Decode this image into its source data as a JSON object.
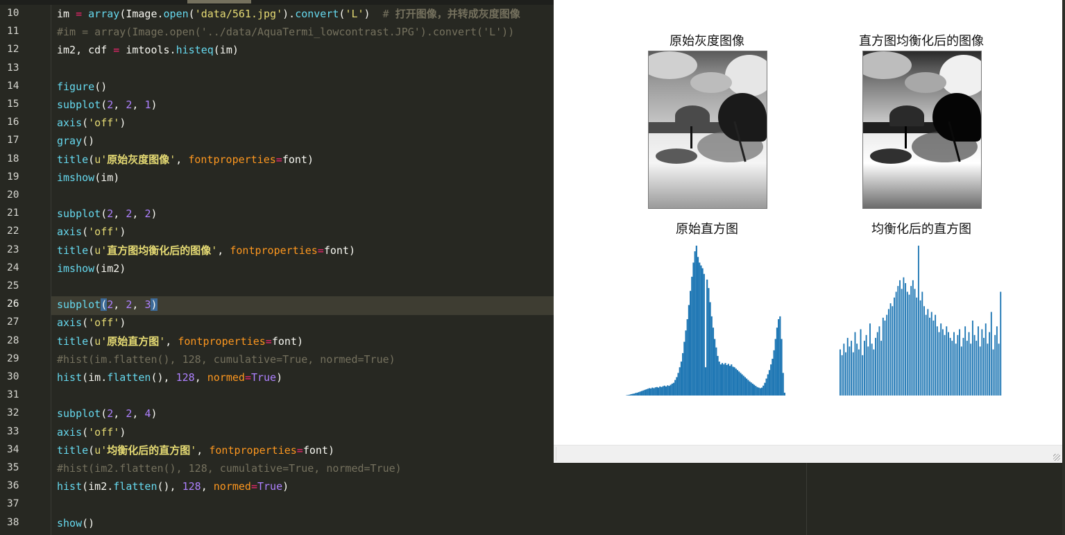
{
  "editor": {
    "lines": [
      {
        "num": "10",
        "tokens": [
          {
            "t": "im ",
            "c": "kw"
          },
          {
            "t": "=",
            "c": "op"
          },
          {
            "t": " ",
            "c": "kw"
          },
          {
            "t": "array",
            "c": "fn"
          },
          {
            "t": "(Image.",
            "c": "kw"
          },
          {
            "t": "open",
            "c": "fn"
          },
          {
            "t": "(",
            "c": "kw"
          },
          {
            "t": "'data/561.jpg'",
            "c": "str"
          },
          {
            "t": ").",
            "c": "kw"
          },
          {
            "t": "convert",
            "c": "fn"
          },
          {
            "t": "(",
            "c": "kw"
          },
          {
            "t": "'L'",
            "c": "str"
          },
          {
            "t": ")  ",
            "c": "kw"
          },
          {
            "t": "# ",
            "c": "comment"
          },
          {
            "t": "打开图像，并转成灰度图像",
            "c": "cjk-comment"
          }
        ]
      },
      {
        "num": "11",
        "tokens": [
          {
            "t": "#im = array(Image.open('../data/AquaTermi_lowcontrast.JPG').convert('L'))",
            "c": "comment"
          }
        ]
      },
      {
        "num": "12",
        "tokens": [
          {
            "t": "im2, cdf ",
            "c": "kw"
          },
          {
            "t": "=",
            "c": "op"
          },
          {
            "t": " imtools.",
            "c": "kw"
          },
          {
            "t": "histeq",
            "c": "fn"
          },
          {
            "t": "(im)",
            "c": "kw"
          }
        ]
      },
      {
        "num": "13",
        "tokens": []
      },
      {
        "num": "14",
        "tokens": [
          {
            "t": "figure",
            "c": "fn"
          },
          {
            "t": "()",
            "c": "kw"
          }
        ]
      },
      {
        "num": "15",
        "tokens": [
          {
            "t": "subplot",
            "c": "fn"
          },
          {
            "t": "(",
            "c": "kw"
          },
          {
            "t": "2",
            "c": "num"
          },
          {
            "t": ", ",
            "c": "kw"
          },
          {
            "t": "2",
            "c": "num"
          },
          {
            "t": ", ",
            "c": "kw"
          },
          {
            "t": "1",
            "c": "num"
          },
          {
            "t": ")",
            "c": "kw"
          }
        ]
      },
      {
        "num": "16",
        "tokens": [
          {
            "t": "axis",
            "c": "fn"
          },
          {
            "t": "(",
            "c": "kw"
          },
          {
            "t": "'off'",
            "c": "str"
          },
          {
            "t": ")",
            "c": "kw"
          }
        ]
      },
      {
        "num": "17",
        "tokens": [
          {
            "t": "gray",
            "c": "fn"
          },
          {
            "t": "()",
            "c": "kw"
          }
        ]
      },
      {
        "num": "18",
        "tokens": [
          {
            "t": "title",
            "c": "fn"
          },
          {
            "t": "(",
            "c": "kw"
          },
          {
            "t": "u'",
            "c": "str"
          },
          {
            "t": "原始灰度图像",
            "c": "cjk"
          },
          {
            "t": "'",
            "c": "str"
          },
          {
            "t": ", ",
            "c": "kw"
          },
          {
            "t": "fontproperties",
            "c": "param"
          },
          {
            "t": "=",
            "c": "op"
          },
          {
            "t": "font)",
            "c": "kw"
          }
        ]
      },
      {
        "num": "19",
        "tokens": [
          {
            "t": "imshow",
            "c": "fn"
          },
          {
            "t": "(im)",
            "c": "kw"
          }
        ]
      },
      {
        "num": "20",
        "tokens": []
      },
      {
        "num": "21",
        "tokens": [
          {
            "t": "subplot",
            "c": "fn"
          },
          {
            "t": "(",
            "c": "kw"
          },
          {
            "t": "2",
            "c": "num"
          },
          {
            "t": ", ",
            "c": "kw"
          },
          {
            "t": "2",
            "c": "num"
          },
          {
            "t": ", ",
            "c": "kw"
          },
          {
            "t": "2",
            "c": "num"
          },
          {
            "t": ")",
            "c": "kw"
          }
        ]
      },
      {
        "num": "22",
        "tokens": [
          {
            "t": "axis",
            "c": "fn"
          },
          {
            "t": "(",
            "c": "kw"
          },
          {
            "t": "'off'",
            "c": "str"
          },
          {
            "t": ")",
            "c": "kw"
          }
        ]
      },
      {
        "num": "23",
        "tokens": [
          {
            "t": "title",
            "c": "fn"
          },
          {
            "t": "(",
            "c": "kw"
          },
          {
            "t": "u'",
            "c": "str"
          },
          {
            "t": "直方图均衡化后的图像",
            "c": "cjk"
          },
          {
            "t": "'",
            "c": "str"
          },
          {
            "t": ", ",
            "c": "kw"
          },
          {
            "t": "fontproperties",
            "c": "param"
          },
          {
            "t": "=",
            "c": "op"
          },
          {
            "t": "font)",
            "c": "kw"
          }
        ]
      },
      {
        "num": "24",
        "tokens": [
          {
            "t": "imshow",
            "c": "fn"
          },
          {
            "t": "(im2)",
            "c": "kw"
          }
        ]
      },
      {
        "num": "25",
        "tokens": []
      },
      {
        "num": "26",
        "active": true,
        "tokens": [
          {
            "t": "subplot",
            "c": "fn"
          },
          {
            "t": "(",
            "c": "bracket-hl"
          },
          {
            "t": "2",
            "c": "num"
          },
          {
            "t": ", ",
            "c": "kw"
          },
          {
            "t": "2",
            "c": "num"
          },
          {
            "t": ", ",
            "c": "kw"
          },
          {
            "t": "3",
            "c": "num"
          },
          {
            "t": ")",
            "c": "bracket-hl"
          }
        ]
      },
      {
        "num": "27",
        "tokens": [
          {
            "t": "axis",
            "c": "fn"
          },
          {
            "t": "(",
            "c": "kw"
          },
          {
            "t": "'off'",
            "c": "str"
          },
          {
            "t": ")",
            "c": "kw"
          }
        ]
      },
      {
        "num": "28",
        "tokens": [
          {
            "t": "title",
            "c": "fn"
          },
          {
            "t": "(",
            "c": "kw"
          },
          {
            "t": "u'",
            "c": "str"
          },
          {
            "t": "原始直方图",
            "c": "cjk"
          },
          {
            "t": "'",
            "c": "str"
          },
          {
            "t": ", ",
            "c": "kw"
          },
          {
            "t": "fontproperties",
            "c": "param"
          },
          {
            "t": "=",
            "c": "op"
          },
          {
            "t": "font)",
            "c": "kw"
          }
        ]
      },
      {
        "num": "29",
        "tokens": [
          {
            "t": "#hist(im.flatten(), 128, cumulative=True, normed=True)",
            "c": "comment"
          }
        ]
      },
      {
        "num": "30",
        "tokens": [
          {
            "t": "hist",
            "c": "fn"
          },
          {
            "t": "(im.",
            "c": "kw"
          },
          {
            "t": "flatten",
            "c": "fn"
          },
          {
            "t": "(), ",
            "c": "kw"
          },
          {
            "t": "128",
            "c": "num"
          },
          {
            "t": ", ",
            "c": "kw"
          },
          {
            "t": "normed",
            "c": "param"
          },
          {
            "t": "=",
            "c": "op"
          },
          {
            "t": "True",
            "c": "const"
          },
          {
            "t": ")",
            "c": "kw"
          }
        ]
      },
      {
        "num": "31",
        "tokens": []
      },
      {
        "num": "32",
        "tokens": [
          {
            "t": "subplot",
            "c": "fn"
          },
          {
            "t": "(",
            "c": "kw"
          },
          {
            "t": "2",
            "c": "num"
          },
          {
            "t": ", ",
            "c": "kw"
          },
          {
            "t": "2",
            "c": "num"
          },
          {
            "t": ", ",
            "c": "kw"
          },
          {
            "t": "4",
            "c": "num"
          },
          {
            "t": ")",
            "c": "kw"
          }
        ]
      },
      {
        "num": "33",
        "tokens": [
          {
            "t": "axis",
            "c": "fn"
          },
          {
            "t": "(",
            "c": "kw"
          },
          {
            "t": "'off'",
            "c": "str"
          },
          {
            "t": ")",
            "c": "kw"
          }
        ]
      },
      {
        "num": "34",
        "tokens": [
          {
            "t": "title",
            "c": "fn"
          },
          {
            "t": "(",
            "c": "kw"
          },
          {
            "t": "u'",
            "c": "str"
          },
          {
            "t": "均衡化后的直方图",
            "c": "cjk"
          },
          {
            "t": "'",
            "c": "str"
          },
          {
            "t": ", ",
            "c": "kw"
          },
          {
            "t": "fontproperties",
            "c": "param"
          },
          {
            "t": "=",
            "c": "op"
          },
          {
            "t": "font)",
            "c": "kw"
          }
        ]
      },
      {
        "num": "35",
        "tokens": [
          {
            "t": "#hist(im2.flatten(), 128, cumulative=True, normed=True)",
            "c": "comment"
          }
        ]
      },
      {
        "num": "36",
        "tokens": [
          {
            "t": "hist",
            "c": "fn"
          },
          {
            "t": "(im2.",
            "c": "kw"
          },
          {
            "t": "flatten",
            "c": "fn"
          },
          {
            "t": "(), ",
            "c": "kw"
          },
          {
            "t": "128",
            "c": "num"
          },
          {
            "t": ", ",
            "c": "kw"
          },
          {
            "t": "normed",
            "c": "param"
          },
          {
            "t": "=",
            "c": "op"
          },
          {
            "t": "True",
            "c": "const"
          },
          {
            "t": ")",
            "c": "kw"
          }
        ]
      },
      {
        "num": "37",
        "tokens": []
      },
      {
        "num": "38",
        "tokens": [
          {
            "t": "show",
            "c": "fn"
          },
          {
            "t": "()",
            "c": "kw"
          }
        ]
      }
    ]
  },
  "figure": {
    "titles": {
      "original_image": "原始灰度图像",
      "equalized_image": "直方图均衡化后的图像",
      "original_hist": "原始直方图",
      "equalized_hist": "均衡化后的直方图"
    },
    "bar_color": "#1f77b4"
  },
  "chart_data": [
    {
      "type": "bar",
      "title": "原始直方图",
      "bins": 128,
      "values": [
        0.1,
        0.2,
        0.3,
        0.5,
        0.6,
        0.7,
        0.9,
        1.0,
        1.2,
        1.4,
        1.6,
        1.8,
        2.0,
        2.2,
        2.4,
        2.6,
        2.5,
        2.8,
        2.6,
        2.9,
        3.0,
        2.8,
        3.2,
        3.0,
        3.3,
        3.5,
        3.2,
        3.6,
        3.4,
        3.8,
        4.2,
        4.5,
        5.5,
        6.5,
        8.0,
        10.0,
        12.0,
        15.0,
        19.0,
        23.0,
        27.0,
        32.0,
        37.0,
        42.0,
        47.0,
        51.0,
        53.0,
        49.0,
        47.0,
        46.0,
        45.0,
        43.0,
        10.0,
        41.0,
        38.0,
        33.0,
        28.0,
        24.0,
        20.0,
        17.0,
        14.0,
        12.0,
        11.0,
        11.5,
        11.0,
        11.5,
        10.8,
        11.2,
        10.5,
        11.0,
        10.2,
        10.0,
        9.5,
        9.0,
        8.5,
        8.0,
        7.5,
        7.0,
        6.5,
        6.0,
        5.5,
        5.0,
        4.6,
        4.2,
        3.8,
        3.4,
        3.0,
        2.8,
        2.6,
        2.8,
        3.5,
        4.5,
        6.0,
        7.5,
        9.0,
        11.0,
        13.0,
        16.0,
        20.0,
        24.0,
        27.0,
        28.0,
        20.0,
        8.0,
        1.0
      ],
      "axis": "off"
    },
    {
      "type": "bar",
      "title": "均衡化后的直方图",
      "bins": 128,
      "values": [
        16,
        14,
        18,
        15,
        20,
        17,
        19,
        15,
        22,
        18,
        16,
        23,
        14,
        19,
        21,
        17,
        25,
        18,
        16,
        20,
        22,
        24,
        19,
        27,
        26,
        28,
        30,
        32,
        31,
        34,
        36,
        38,
        40,
        37,
        41,
        39,
        36,
        35,
        38,
        40,
        37,
        34,
        52,
        33,
        36,
        31,
        28,
        30,
        27,
        29,
        26,
        28,
        24,
        22,
        25,
        23,
        21,
        24,
        22,
        20,
        19,
        22,
        18,
        21,
        23,
        17,
        20,
        24,
        19,
        22,
        18,
        26,
        21,
        19,
        24,
        17,
        23,
        20,
        25,
        18,
        22,
        29,
        16,
        21,
        24,
        18,
        36
      ],
      "axis": "off"
    }
  ]
}
